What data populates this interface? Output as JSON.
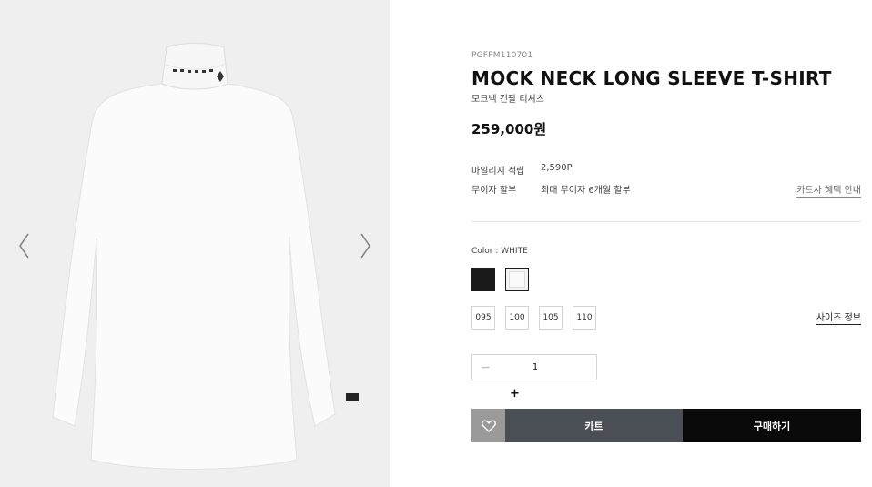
{
  "gallery": {
    "prev_icon": "chevron-left-icon",
    "next_icon": "chevron-right-icon",
    "image": "white mock neck long sleeve t-shirt",
    "brand_mark": "PXG"
  },
  "product": {
    "sku": "PGFPM110701",
    "name": "MOCK NECK LONG SLEEVE T-SHIRT",
    "name_ko": "모크넥 긴팔 티셔츠",
    "price": "259,000원"
  },
  "benefits": {
    "mileage_label": "마일리지 적립",
    "mileage_value": "2,590P",
    "installment_label": "무이자 할부",
    "installment_value": "최대 무이자 6개월 할부",
    "card_link": "카드사 혜택 안내"
  },
  "options": {
    "color_label": "Color : WHITE",
    "colors": [
      "#1a1a1a",
      "#f4f4f4"
    ],
    "sizes": [
      "095",
      "100",
      "105",
      "110"
    ],
    "size_guide": "사이즈 정보"
  },
  "quantity": {
    "minus": "—",
    "value": "1",
    "plus": "+"
  },
  "actions": {
    "wish_icon": "heart-icon",
    "cart": "카트",
    "buy": "구매하기"
  }
}
